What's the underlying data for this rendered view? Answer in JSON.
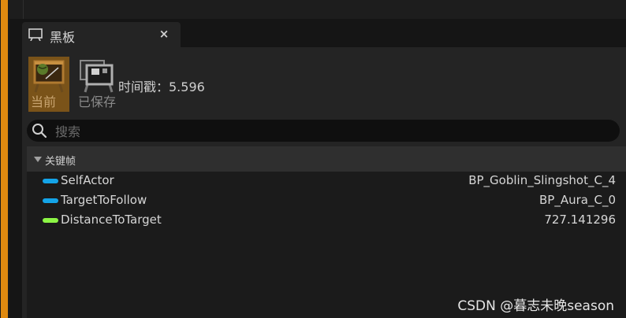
{
  "tab": {
    "icon": "blackboard-tab-icon",
    "title": "黑板",
    "close_label": "×"
  },
  "blackboard": {
    "current_label": "当前",
    "saved_label": "已保存",
    "timestamp": "时间戳：5.596"
  },
  "search": {
    "placeholder": "搜索",
    "value": ""
  },
  "category": {
    "label": "关键帧"
  },
  "keys": [
    {
      "name": "SelfActor",
      "value": "BP_Goblin_Slingshot_C_4",
      "color": "#14a4e8"
    },
    {
      "name": "TargetToFollow",
      "value": "BP_Aura_C_0",
      "color": "#14a4e8"
    },
    {
      "name": "DistanceToTarget",
      "value": "727.141296",
      "color": "#8cf545"
    }
  ],
  "watermark": "CSDN @暮志未晚season",
  "colors": {
    "accent_orange": "#e08a10",
    "object_key": "#14a4e8",
    "float_key": "#8cf545",
    "current_button_bg": "#7a5319"
  }
}
